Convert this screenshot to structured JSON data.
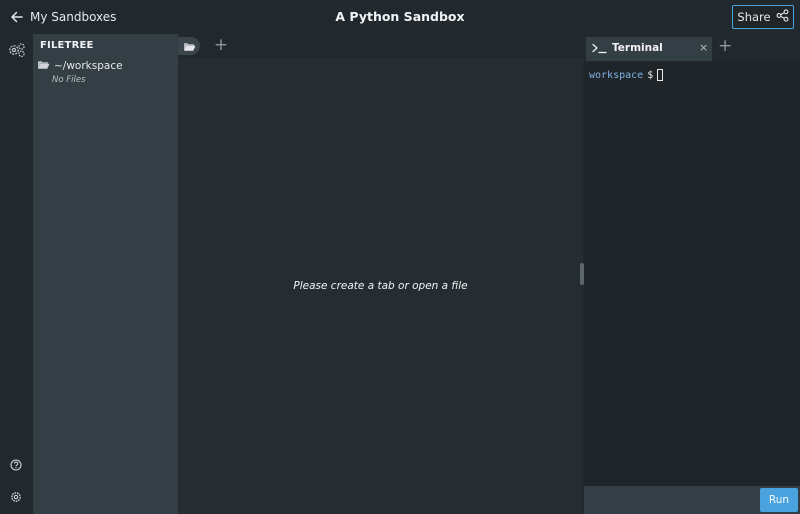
{
  "header": {
    "back_label": "My Sandboxes",
    "title": "A Python Sandbox",
    "share_label": "Share"
  },
  "filetree": {
    "heading": "FILETREE",
    "root_folder": "~/workspace",
    "empty_text": "No Files"
  },
  "editor": {
    "empty_message": "Please create a tab or open a file",
    "add_tab_symbol": "+"
  },
  "terminal": {
    "tab_label": "Terminal",
    "close_symbol": "×",
    "add_symbol": "+",
    "prompt_dir": "workspace",
    "prompt_symbol": "$"
  },
  "run_bar": {
    "run_label": "Run"
  },
  "colors": {
    "accent": "#4aa3df",
    "sidebar_bg": "#343e45",
    "editor_bg": "#262d32",
    "terminal_bg": "#1f2528",
    "terminal_dir": "#7fb2e6"
  },
  "icons": {
    "back": "arrow-left-icon",
    "share": "share-icon",
    "settings_group": "gears-icon",
    "help": "help-circle-icon",
    "settings": "gear-icon",
    "folder": "folder-open-icon",
    "terminal": "terminal-prompt-icon"
  }
}
